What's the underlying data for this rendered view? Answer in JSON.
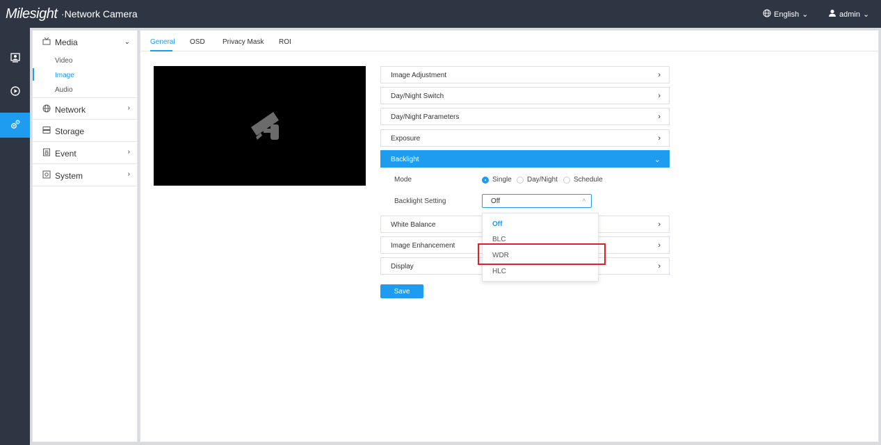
{
  "header": {
    "brand": "Milesight",
    "product": "·Network Camera",
    "language": "English",
    "user": "admin"
  },
  "rail": {
    "icons": [
      "live-view-icon",
      "playback-icon",
      "settings-icon"
    ]
  },
  "sidebar": {
    "media": {
      "label": "Media",
      "subitems": [
        "Video",
        "Image",
        "Audio"
      ],
      "active": "Image"
    },
    "items": [
      {
        "label": "Network"
      },
      {
        "label": "Storage"
      },
      {
        "label": "Event"
      },
      {
        "label": "System"
      }
    ]
  },
  "tabs": [
    "General",
    "OSD",
    "Privacy Mask",
    "ROI"
  ],
  "sections": {
    "image_adjustment": "Image Adjustment",
    "day_night_switch": "Day/Night Switch",
    "day_night_parameters": "Day/Night Parameters",
    "exposure": "Exposure",
    "backlight": "Backlight",
    "white_balance": "White Balance",
    "image_enhancement": "Image Enhancement",
    "display": "Display"
  },
  "backlight": {
    "mode_label": "Mode",
    "modes": [
      "Single",
      "Day/Night",
      "Schedule"
    ],
    "selected_mode": "Single",
    "setting_label": "Backlight Setting",
    "setting_value": "Off",
    "options": [
      "Off",
      "BLC",
      "WDR",
      "HLC"
    ]
  },
  "actions": {
    "save": "Save"
  },
  "colors": {
    "accent": "#1e9cf0",
    "topbar": "#2f3643",
    "highlight": "#e02020"
  }
}
